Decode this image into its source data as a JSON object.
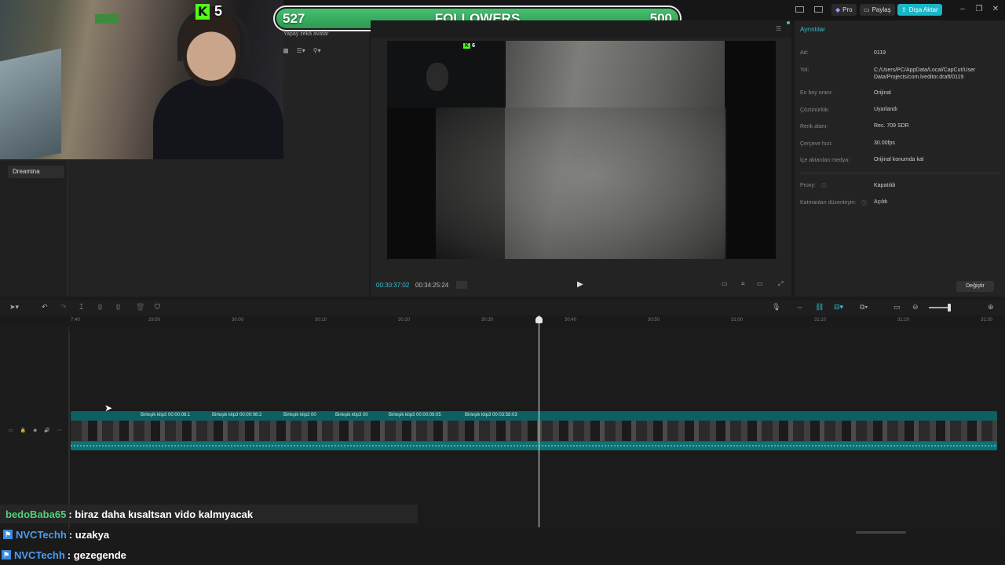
{
  "topbar": {
    "pro_label": "Pro",
    "share_label": "Paylaş",
    "export_label": "Dışa Aktar"
  },
  "overlay": {
    "kick_count": "5",
    "followers_current": "527",
    "followers_label": "FOLLOWERS",
    "followers_goal": "500",
    "followers_progress": 1.0
  },
  "left_panel": {
    "ai_avatar_label": "Yapay zekâ avatar",
    "sidebar_item": "Dreamina"
  },
  "player": {
    "pip_badge": "6",
    "timecode_current": "00:30:37:02",
    "timecode_total": "00:34:25:24"
  },
  "details": {
    "title": "Ayrıntılar",
    "rows": [
      {
        "label": "Ad:",
        "value": "0119"
      },
      {
        "label": "Yol:",
        "value": "C:/Users/PC/AppData/Local/CapCut/User Data/Projects/com.lveditor.draft/0119"
      },
      {
        "label": "En boy oranı:",
        "value": "Orijinal"
      },
      {
        "label": "Çözünürlük:",
        "value": "Uyarlandı"
      },
      {
        "label": "Renk alanı:",
        "value": "Rec. 709 SDR"
      },
      {
        "label": "Çerçeve hızı:",
        "value": "30.00fps"
      },
      {
        "label": "İçe aktarılan medya:",
        "value": "Orijinal konumda kal"
      },
      {
        "label": "Proxy:",
        "value": "Kapatıldı"
      },
      {
        "label": "Katmanları düzenleyin:",
        "value": "Açıldı"
      }
    ],
    "change_button": "Değiştir"
  },
  "timeline": {
    "ticks": [
      "7:40",
      "29:50",
      "30:00",
      "30:10",
      "30:20",
      "30:30",
      "30:40",
      "30:50",
      "31:00",
      "31:10",
      "31:20",
      "31:30"
    ],
    "clips": [
      {
        "label": "Birleşik klip3   00:00:08:1"
      },
      {
        "label": "Birleşik klip3   00:00:08:2"
      },
      {
        "label": "Birleşik klip3   00"
      },
      {
        "label": "Birleşik klip3   00"
      },
      {
        "label": "Birleşik klip3   00:00:09:05"
      },
      {
        "label": "Birleşik klip3   00:03:58:03"
      }
    ]
  },
  "chat": [
    {
      "user": "bedoBaba65",
      "user_color": "#4fd17a",
      "message": ": biraz daha kısaltsan vido kalmıyacak"
    },
    {
      "user": "NVCTechh",
      "user_color": "#4a9df0",
      "message": ": uzakya"
    },
    {
      "user": "NVCTechh",
      "user_color": "#4a9df0",
      "message": ": gezegende"
    }
  ],
  "colors": {
    "accent": "#2fc4d4",
    "export_button": "#19b6c8",
    "clip_track": "#0e5f61",
    "kick_green": "#53fc18"
  }
}
